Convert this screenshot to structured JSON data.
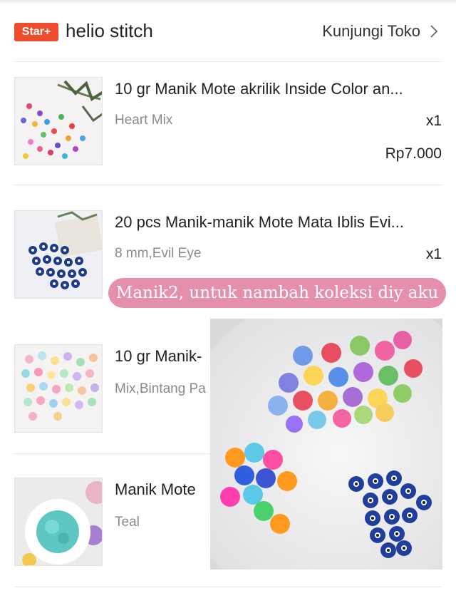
{
  "shop": {
    "badge": "Star+",
    "name": "helio stitch",
    "visit_label": "Kunjungi Toko"
  },
  "items": [
    {
      "title": "10 gr Manik Mote akrilik Inside Color an...",
      "variant": "Heart Mix",
      "qty": "x1",
      "price": "Rp7.000"
    },
    {
      "title": "20 pcs Manik-manik Mote Mata Iblis Evi...",
      "variant": "8 mm,Evil Eye",
      "qty": "x1"
    },
    {
      "title": "10 gr Manik-",
      "variant": "Mix,Bintang Pa"
    },
    {
      "title": "Manik Mote",
      "variant": "Teal"
    }
  ],
  "caption": "Manik2, untuk nambah koleksi diy aku",
  "icons": {
    "chevron": "chevron-right-icon"
  },
  "colors": {
    "badge": "#ee4d2d",
    "caption_bg": "#e58fae"
  }
}
